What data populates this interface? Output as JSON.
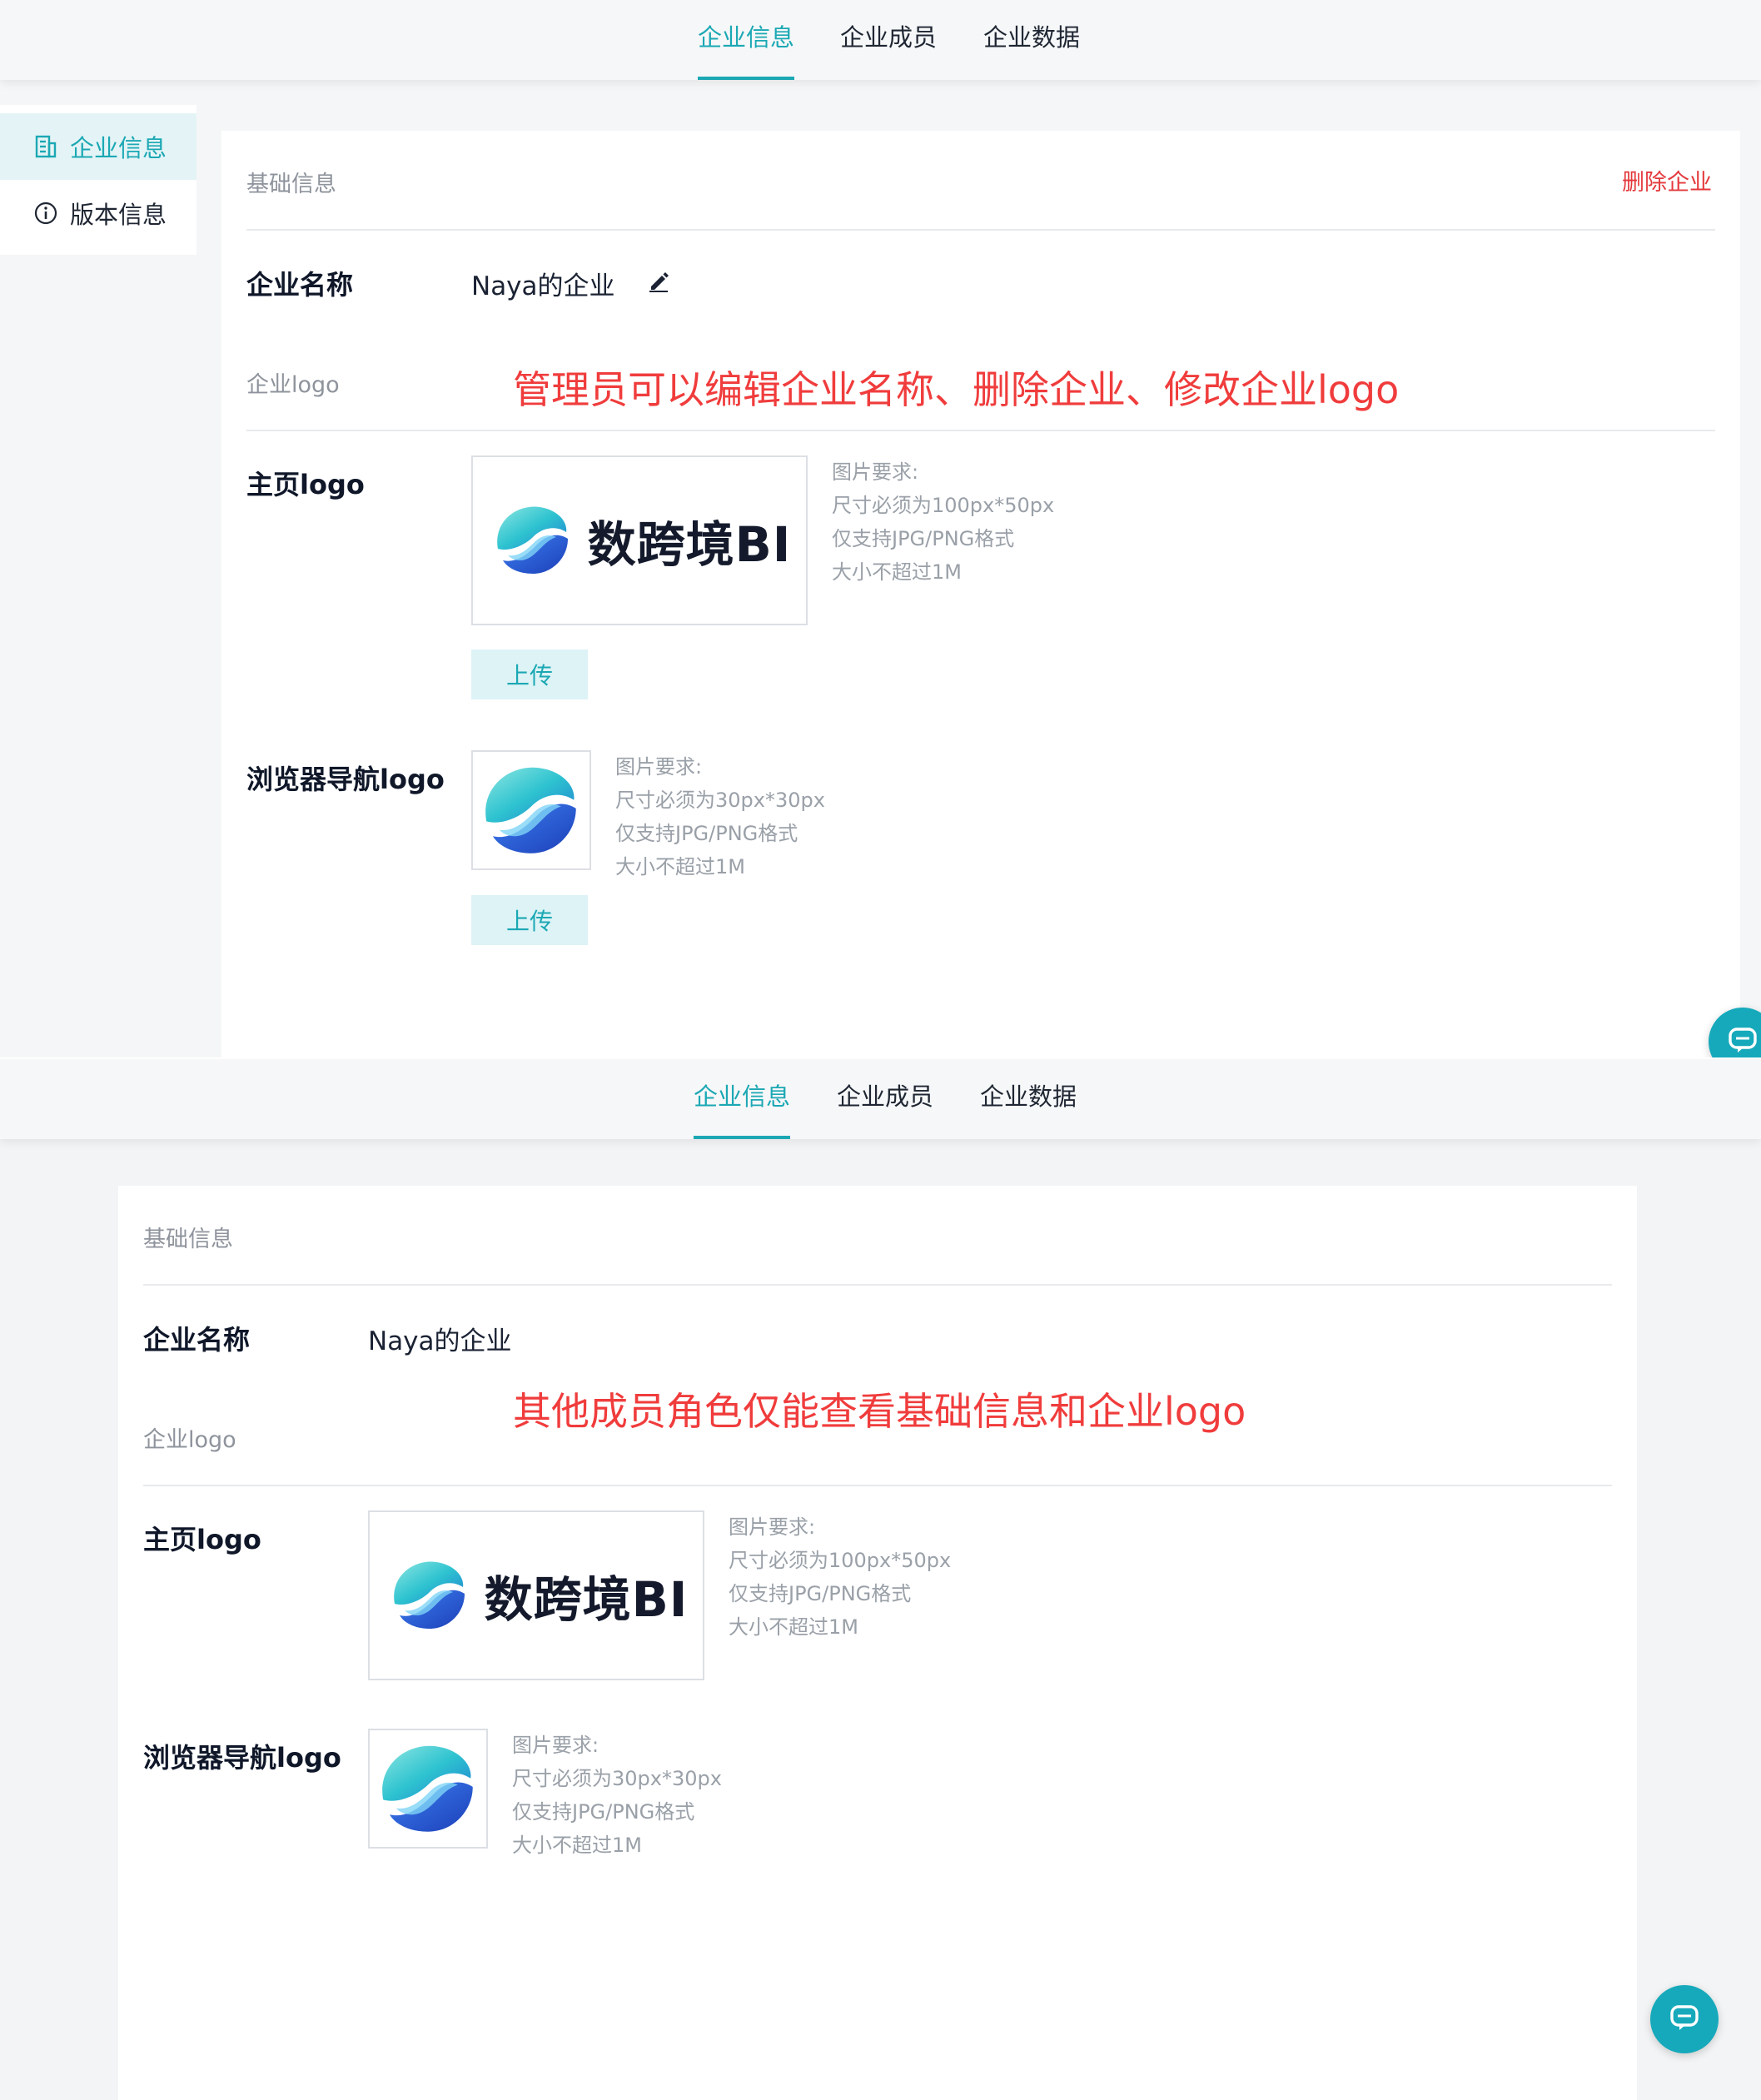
{
  "colors": {
    "accent": "#1ba8b4",
    "danger": "#e4393c",
    "annotation": "#f03c3c"
  },
  "top_nav": {
    "tabs": [
      {
        "label": "企业信息",
        "active": true
      },
      {
        "label": "企业成员",
        "active": false
      },
      {
        "label": "企业数据",
        "active": false
      }
    ]
  },
  "side_menu": {
    "items": [
      {
        "label": "企业信息",
        "icon": "building-icon",
        "active": true
      },
      {
        "label": "版本信息",
        "icon": "info-circle-icon",
        "active": false
      }
    ]
  },
  "admin_view": {
    "section_title": "基础信息",
    "delete_label": "删除企业",
    "company_name_label": "企业名称",
    "company_name": "Naya的企业",
    "logo_section_label": "企业logo",
    "annotation": "管理员可以编辑企业名称、删除企业、修改企业logo",
    "home_logo": {
      "label": "主页logo",
      "wordmark": "数跨境BI",
      "requirements": [
        "图片要求:",
        "尺寸必须为100px*50px",
        "仅支持JPG/PNG格式",
        "大小不超过1M"
      ],
      "upload_label": "上传"
    },
    "browser_logo": {
      "label": "浏览器导航logo",
      "requirements": [
        "图片要求:",
        "尺寸必须为30px*30px",
        "仅支持JPG/PNG格式",
        "大小不超过1M"
      ],
      "upload_label": "上传"
    }
  },
  "member_view": {
    "section_title": "基础信息",
    "company_name_label": "企业名称",
    "company_name": "Naya的企业",
    "logo_section_label": "企业logo",
    "annotation": "其他成员角色仅能查看基础信息和企业logo",
    "home_logo": {
      "label": "主页logo",
      "wordmark": "数跨境BI",
      "requirements": [
        "图片要求:",
        "尺寸必须为100px*50px",
        "仅支持JPG/PNG格式",
        "大小不超过1M"
      ]
    },
    "browser_logo": {
      "label": "浏览器导航logo",
      "requirements": [
        "图片要求:",
        "尺寸必须为30px*30px",
        "仅支持JPG/PNG格式",
        "大小不超过1M"
      ]
    }
  }
}
